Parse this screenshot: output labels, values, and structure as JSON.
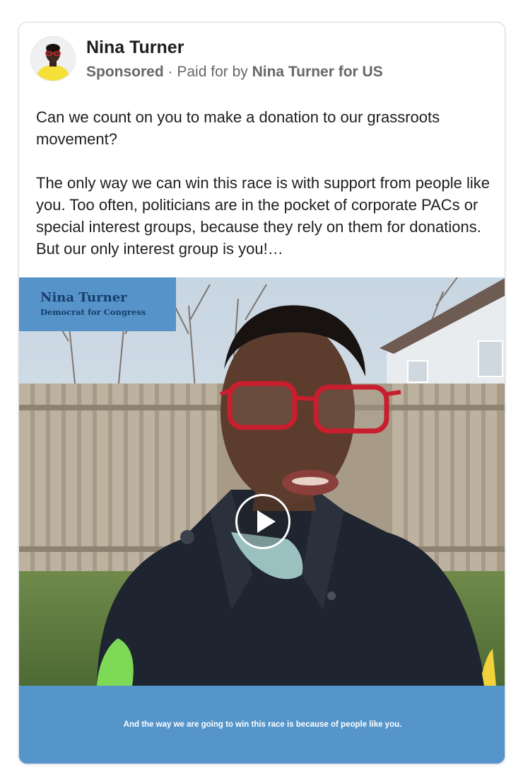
{
  "post": {
    "author": "Nina Turner",
    "sponsored": "Sponsored",
    "separator": "·",
    "paid_for_prefix": "Paid for by",
    "paid_for_by": "Nina Turner for US",
    "body_p1": "Can we count on you to make a donation to our grassroots movement?",
    "body_p2": "The only way we can win this race is with support from people like you. Too often, politicians are in the pocket of corporate PACs or special interest groups, because they rely on them for donations. But our only interest group is you!…"
  },
  "video": {
    "overlay_name": "Nina Turner",
    "overlay_title": "Democrat for Congress",
    "caption": "And the way we are going to win this race is because of people like you.",
    "play_icon": "play-icon"
  },
  "colors": {
    "overlay_blue": "#5593c9",
    "overlay_text": "#173e6a",
    "author_text": "#1c1e21",
    "meta_text": "#65676b"
  }
}
